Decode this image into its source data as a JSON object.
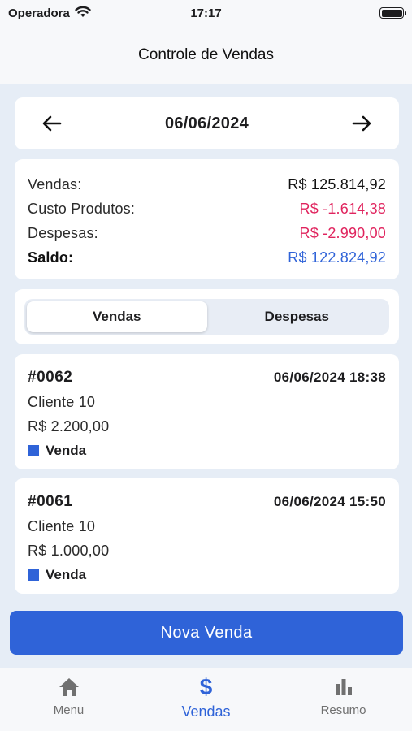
{
  "status_bar": {
    "carrier": "Operadora",
    "time": "17:17"
  },
  "nav": {
    "title": "Controle de Vendas"
  },
  "date_selector": {
    "date": "06/06/2024"
  },
  "summary": {
    "vendas_label": "Vendas:",
    "vendas_value": "R$ 125.814,92",
    "custo_label": "Custo Produtos:",
    "custo_value": "R$ -1.614,38",
    "despesas_label": "Despesas:",
    "despesas_value": "R$ -2.990,00",
    "saldo_label": "Saldo:",
    "saldo_value": "R$ 122.824,92"
  },
  "segment": {
    "option1": "Vendas",
    "option2": "Despesas",
    "selected": "Vendas"
  },
  "sales": [
    {
      "id": "#0062",
      "datetime": "06/06/2024 18:38",
      "client": "Cliente 10",
      "amount": "R$ 2.200,00",
      "type": "Venda"
    },
    {
      "id": "#0061",
      "datetime": "06/06/2024 15:50",
      "client": "Cliente 10",
      "amount": "R$ 1.000,00",
      "type": "Venda"
    }
  ],
  "actions": {
    "new_sale": "Nova Venda"
  },
  "tabs": {
    "menu": "Menu",
    "vendas": "Vendas",
    "resumo": "Resumo",
    "active": "Vendas"
  },
  "colors": {
    "accent": "#2f63d8",
    "negative": "#e0245e",
    "background": "#e6edf6"
  },
  "icons": [
    "wifi-icon",
    "battery-icon",
    "arrow-left-icon",
    "arrow-right-icon",
    "home-icon",
    "dollar-icon",
    "bar-chart-icon"
  ]
}
